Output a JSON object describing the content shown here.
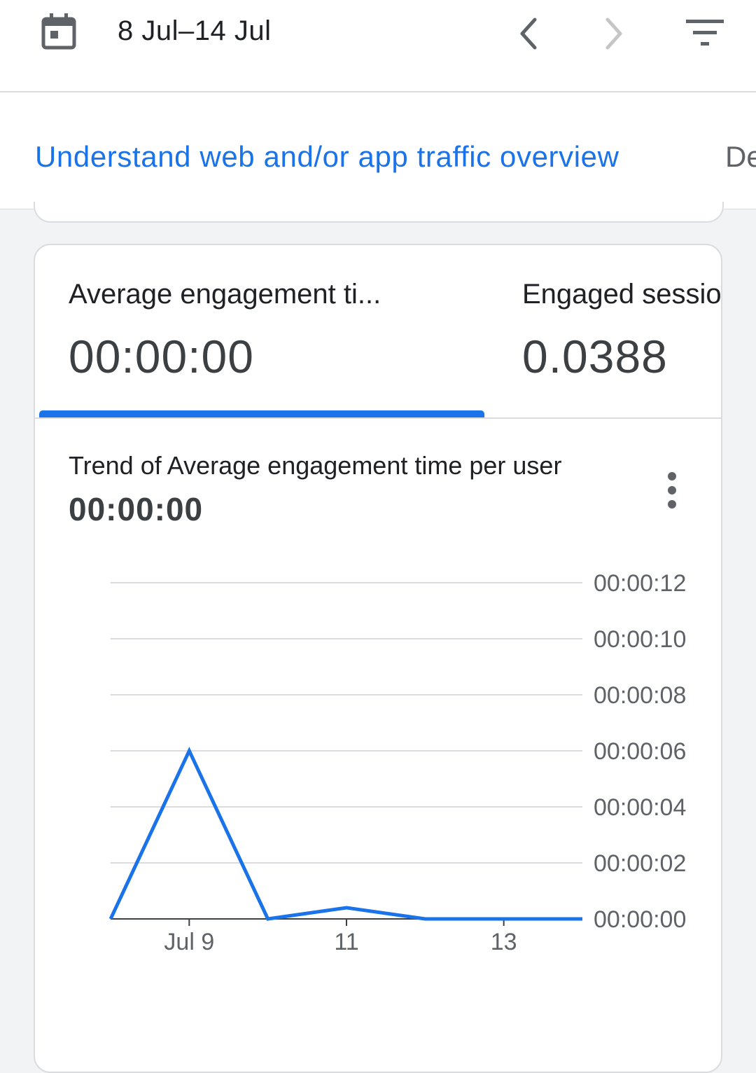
{
  "header": {
    "date_range": "8 Jul–14 Jul",
    "icons": {
      "calendar": "calendar-icon",
      "previous": "chevron-left-icon",
      "next": "chevron-right-icon",
      "filter": "filter-icon"
    }
  },
  "tabs": [
    {
      "label": "Understand web and/or app traffic overview",
      "active": true
    },
    {
      "label": "De",
      "active": false
    }
  ],
  "metrics": [
    {
      "label": "Average engagement ti...",
      "value": "00:00:00",
      "selected": true
    },
    {
      "label": "Engaged sessio",
      "value": "0.0388",
      "selected": false
    }
  ],
  "chart_card": {
    "title": "Trend of Average engagement time per user",
    "total": "00:00:00",
    "menu_icon": "more-vert-icon"
  },
  "chart_data": {
    "type": "line",
    "x": [
      "Jul 8",
      "Jul 9",
      "Jul 10",
      "Jul 11",
      "Jul 12",
      "Jul 13",
      "Jul 14"
    ],
    "x_tick_labels": [
      {
        "x": "Jul 9",
        "label": "Jul 9"
      },
      {
        "x": "Jul 11",
        "label": "11"
      },
      {
        "x": "Jul 13",
        "label": "13"
      }
    ],
    "y_tick_labels": [
      "00:00:00",
      "00:00:02",
      "00:00:04",
      "00:00:06",
      "00:00:08",
      "00:00:10",
      "00:00:12"
    ],
    "y_ticks_seconds": [
      0,
      2,
      4,
      6,
      8,
      10,
      12
    ],
    "ylim_seconds": [
      0,
      12
    ],
    "y_axis_side": "right",
    "grid": true,
    "series": [
      {
        "values_seconds": [
          0,
          6,
          0,
          0.4,
          0,
          0,
          0
        ],
        "color": "#1a73e8"
      }
    ]
  },
  "colors": {
    "accent": "#1a73e8",
    "text": "#202124",
    "muted": "#5f6368",
    "grid": "#dadce0",
    "background": "#f1f3f4"
  }
}
